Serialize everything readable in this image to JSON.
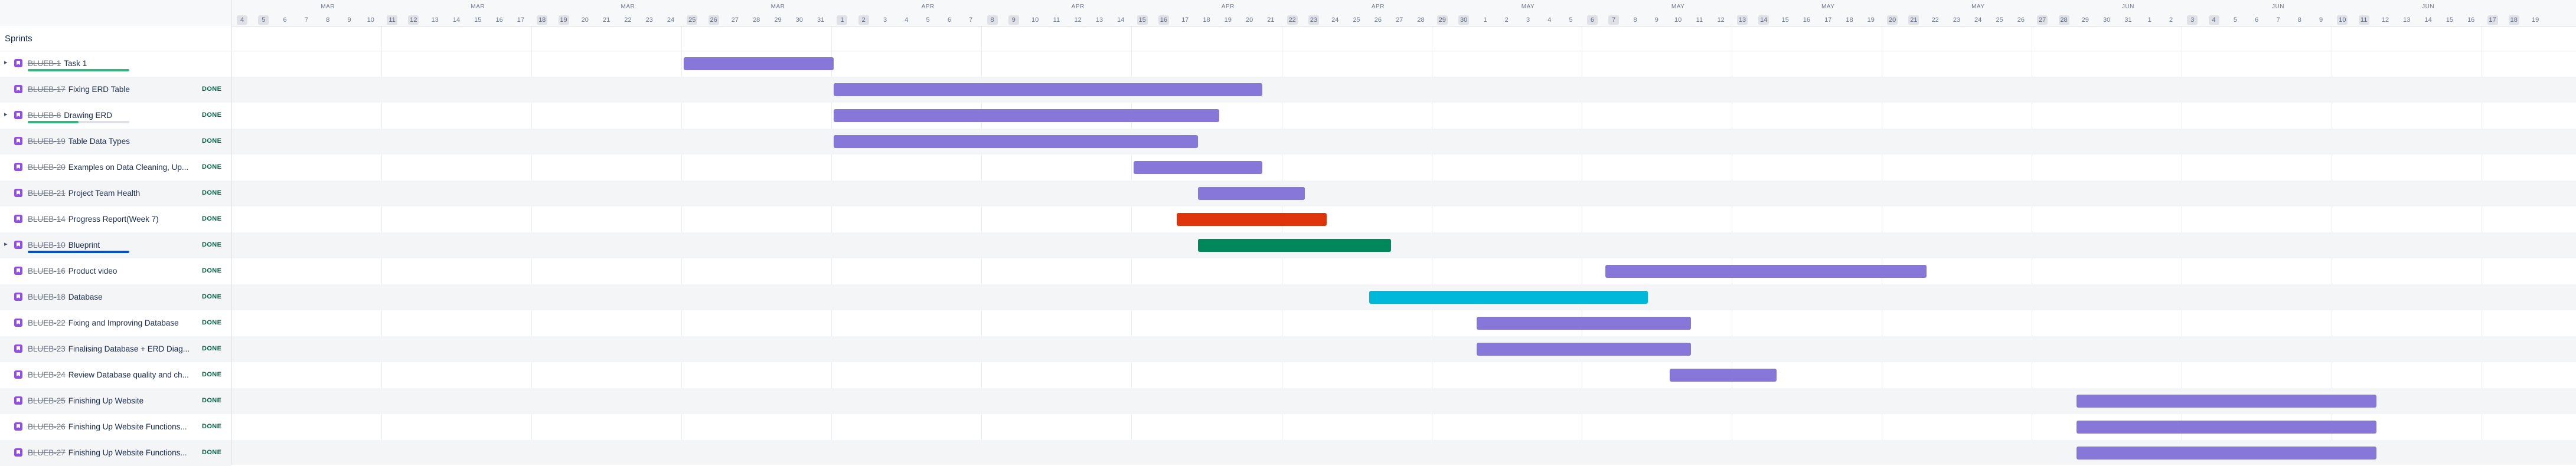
{
  "left": {
    "header_label": "Sprints"
  },
  "colors": {
    "default_bar": "#8777d9",
    "red_bar": "#de350b",
    "green_bar": "#00875a",
    "teal_bar": "#00b8d9",
    "status_done": "#006644",
    "story_icon": "#904ee2"
  },
  "timeline": {
    "months": [
      {
        "label": "MAR",
        "day_index": 4
      },
      {
        "label": "MAR",
        "day_index": 11
      },
      {
        "label": "MAR",
        "day_index": 18
      },
      {
        "label": "MAR",
        "day_index": 25
      },
      {
        "label": "APR",
        "day_index": 32
      },
      {
        "label": "APR",
        "day_index": 39
      },
      {
        "label": "APR",
        "day_index": 46
      },
      {
        "label": "APR",
        "day_index": 53
      },
      {
        "label": "MAY",
        "day_index": 60
      },
      {
        "label": "MAY",
        "day_index": 67
      },
      {
        "label": "MAY",
        "day_index": 74
      },
      {
        "label": "MAY",
        "day_index": 81
      },
      {
        "label": "JUN",
        "day_index": 88
      },
      {
        "label": "JUN",
        "day_index": 95
      },
      {
        "label": "JUN",
        "day_index": 102
      }
    ],
    "days": [
      {
        "label": "4",
        "weekend": true
      },
      {
        "label": "5",
        "weekend": true
      },
      {
        "label": "6",
        "weekend": false
      },
      {
        "label": "7",
        "weekend": false
      },
      {
        "label": "8",
        "weekend": false
      },
      {
        "label": "9",
        "weekend": false
      },
      {
        "label": "10",
        "weekend": false
      },
      {
        "label": "11",
        "weekend": true
      },
      {
        "label": "12",
        "weekend": true
      },
      {
        "label": "13",
        "weekend": false
      },
      {
        "label": "14",
        "weekend": false
      },
      {
        "label": "15",
        "weekend": false
      },
      {
        "label": "16",
        "weekend": false
      },
      {
        "label": "17",
        "weekend": false
      },
      {
        "label": "18",
        "weekend": true
      },
      {
        "label": "19",
        "weekend": true
      },
      {
        "label": "20",
        "weekend": false
      },
      {
        "label": "21",
        "weekend": false
      },
      {
        "label": "22",
        "weekend": false
      },
      {
        "label": "23",
        "weekend": false
      },
      {
        "label": "24",
        "weekend": false
      },
      {
        "label": "25",
        "weekend": true
      },
      {
        "label": "26",
        "weekend": true
      },
      {
        "label": "27",
        "weekend": false
      },
      {
        "label": "28",
        "weekend": false
      },
      {
        "label": "29",
        "weekend": false
      },
      {
        "label": "30",
        "weekend": false
      },
      {
        "label": "31",
        "weekend": false
      },
      {
        "label": "1",
        "weekend": true
      },
      {
        "label": "2",
        "weekend": true
      },
      {
        "label": "3",
        "weekend": false
      },
      {
        "label": "4",
        "weekend": false
      },
      {
        "label": "5",
        "weekend": false
      },
      {
        "label": "6",
        "weekend": false
      },
      {
        "label": "7",
        "weekend": false
      },
      {
        "label": "8",
        "weekend": true
      },
      {
        "label": "9",
        "weekend": true
      },
      {
        "label": "10",
        "weekend": false
      },
      {
        "label": "11",
        "weekend": false
      },
      {
        "label": "12",
        "weekend": false
      },
      {
        "label": "13",
        "weekend": false
      },
      {
        "label": "14",
        "weekend": false
      },
      {
        "label": "15",
        "weekend": true
      },
      {
        "label": "16",
        "weekend": true
      },
      {
        "label": "17",
        "weekend": false
      },
      {
        "label": "18",
        "weekend": false
      },
      {
        "label": "19",
        "weekend": false
      },
      {
        "label": "20",
        "weekend": false
      },
      {
        "label": "21",
        "weekend": false
      },
      {
        "label": "22",
        "weekend": true
      },
      {
        "label": "23",
        "weekend": true
      },
      {
        "label": "24",
        "weekend": false
      },
      {
        "label": "25",
        "weekend": false
      },
      {
        "label": "26",
        "weekend": false
      },
      {
        "label": "27",
        "weekend": false
      },
      {
        "label": "28",
        "weekend": false
      },
      {
        "label": "29",
        "weekend": true
      },
      {
        "label": "30",
        "weekend": true
      },
      {
        "label": "1",
        "weekend": false
      },
      {
        "label": "2",
        "weekend": false
      },
      {
        "label": "3",
        "weekend": false
      },
      {
        "label": "4",
        "weekend": false
      },
      {
        "label": "5",
        "weekend": false
      },
      {
        "label": "6",
        "weekend": true
      },
      {
        "label": "7",
        "weekend": true
      },
      {
        "label": "8",
        "weekend": false
      },
      {
        "label": "9",
        "weekend": false
      },
      {
        "label": "10",
        "weekend": false
      },
      {
        "label": "11",
        "weekend": false
      },
      {
        "label": "12",
        "weekend": false
      },
      {
        "label": "13",
        "weekend": true
      },
      {
        "label": "14",
        "weekend": true
      },
      {
        "label": "15",
        "weekend": false
      },
      {
        "label": "16",
        "weekend": false
      },
      {
        "label": "17",
        "weekend": false
      },
      {
        "label": "18",
        "weekend": false
      },
      {
        "label": "19",
        "weekend": false
      },
      {
        "label": "20",
        "weekend": true
      },
      {
        "label": "21",
        "weekend": true
      },
      {
        "label": "22",
        "weekend": false
      },
      {
        "label": "23",
        "weekend": false
      },
      {
        "label": "24",
        "weekend": false
      },
      {
        "label": "25",
        "weekend": false
      },
      {
        "label": "26",
        "weekend": false
      },
      {
        "label": "27",
        "weekend": true
      },
      {
        "label": "28",
        "weekend": true
      },
      {
        "label": "29",
        "weekend": false
      },
      {
        "label": "30",
        "weekend": false
      },
      {
        "label": "31",
        "weekend": false
      },
      {
        "label": "1",
        "weekend": false
      },
      {
        "label": "2",
        "weekend": false
      },
      {
        "label": "3",
        "weekend": true
      },
      {
        "label": "4",
        "weekend": true
      },
      {
        "label": "5",
        "weekend": false
      },
      {
        "label": "6",
        "weekend": false
      },
      {
        "label": "7",
        "weekend": false
      },
      {
        "label": "8",
        "weekend": false
      },
      {
        "label": "9",
        "weekend": false
      },
      {
        "label": "10",
        "weekend": true
      },
      {
        "label": "11",
        "weekend": true
      },
      {
        "label": "12",
        "weekend": false
      },
      {
        "label": "13",
        "weekend": false
      },
      {
        "label": "14",
        "weekend": false
      },
      {
        "label": "15",
        "weekend": false
      },
      {
        "label": "16",
        "weekend": false
      },
      {
        "label": "17",
        "weekend": true
      },
      {
        "label": "18",
        "weekend": true
      },
      {
        "label": "19",
        "weekend": false
      }
    ]
  },
  "issues": [
    {
      "key": "BLUEB-1",
      "summary": "Task 1",
      "status": "",
      "expandable": true,
      "progress": {
        "done": 1.0,
        "color": "#36b37e"
      },
      "bar": {
        "start": 21.1,
        "end": 28.1,
        "color": "#8777d9"
      }
    },
    {
      "key": "BLUEB-17",
      "summary": "Fixing ERD Table",
      "status": "DONE",
      "expandable": false,
      "progress": null,
      "bar": {
        "start": 28.1,
        "end": 48.1,
        "color": "#8777d9"
      }
    },
    {
      "key": "BLUEB-8",
      "summary": "Drawing ERD",
      "status": "DONE",
      "expandable": true,
      "progress": {
        "done": 0.5,
        "color": "#36b37e"
      },
      "bar": {
        "start": 28.1,
        "end": 46.1,
        "color": "#8777d9"
      }
    },
    {
      "key": "BLUEB-19",
      "summary": "Table Data Types",
      "status": "DONE",
      "expandable": false,
      "progress": null,
      "bar": {
        "start": 28.1,
        "end": 45.1,
        "color": "#8777d9"
      }
    },
    {
      "key": "BLUEB-20",
      "summary": "Examples on Data Cleaning, Up...",
      "status": "DONE",
      "expandable": false,
      "progress": null,
      "bar": {
        "start": 42.1,
        "end": 48.1,
        "color": "#8777d9"
      }
    },
    {
      "key": "BLUEB-21",
      "summary": "Project Team Health",
      "status": "DONE",
      "expandable": false,
      "progress": null,
      "bar": {
        "start": 45.1,
        "end": 50.1,
        "color": "#8777d9"
      }
    },
    {
      "key": "BLUEB-14",
      "summary": "Progress Report(Week 7)",
      "status": "DONE",
      "expandable": false,
      "progress": null,
      "bar": {
        "start": 44.1,
        "end": 51.1,
        "color": "#de350b"
      }
    },
    {
      "key": "BLUEB-10",
      "summary": "Blueprint",
      "status": "DONE",
      "expandable": true,
      "progress": {
        "done": 1.0,
        "color": "#0052cc"
      },
      "bar": {
        "start": 45.1,
        "end": 54.1,
        "color": "#00875a"
      }
    },
    {
      "key": "BLUEB-16",
      "summary": "Product video",
      "status": "DONE",
      "expandable": false,
      "progress": null,
      "bar": {
        "start": 64.1,
        "end": 79.1,
        "color": "#8777d9"
      }
    },
    {
      "key": "BLUEB-18",
      "summary": "Database",
      "status": "DONE",
      "expandable": false,
      "progress": null,
      "bar": {
        "start": 53.1,
        "end": 66.1,
        "color": "#00b8d9"
      }
    },
    {
      "key": "BLUEB-22",
      "summary": "Fixing and Improving Database",
      "status": "DONE",
      "expandable": false,
      "progress": null,
      "bar": {
        "start": 58.1,
        "end": 68.1,
        "color": "#8777d9"
      }
    },
    {
      "key": "BLUEB-23",
      "summary": "Finalising Database + ERD Diag...",
      "status": "DONE",
      "expandable": false,
      "progress": null,
      "bar": {
        "start": 58.1,
        "end": 68.1,
        "color": "#8777d9"
      }
    },
    {
      "key": "BLUEB-24",
      "summary": "Review Database quality and ch...",
      "status": "DONE",
      "expandable": false,
      "progress": null,
      "bar": {
        "start": 67.1,
        "end": 72.1,
        "color": "#8777d9"
      }
    },
    {
      "key": "BLUEB-25",
      "summary": "Finishing Up Website",
      "status": "DONE",
      "expandable": false,
      "progress": null,
      "bar": {
        "start": 86.1,
        "end": 100.1,
        "color": "#8777d9"
      }
    },
    {
      "key": "BLUEB-26",
      "summary": "Finishing Up Website Functions...",
      "status": "DONE",
      "expandable": false,
      "progress": null,
      "bar": {
        "start": 86.1,
        "end": 100.1,
        "color": "#8777d9"
      }
    },
    {
      "key": "BLUEB-27",
      "summary": "Finishing Up Website Functions...",
      "status": "DONE",
      "expandable": false,
      "progress": null,
      "bar": {
        "start": 86.1,
        "end": 100.1,
        "color": "#8777d9"
      }
    }
  ]
}
